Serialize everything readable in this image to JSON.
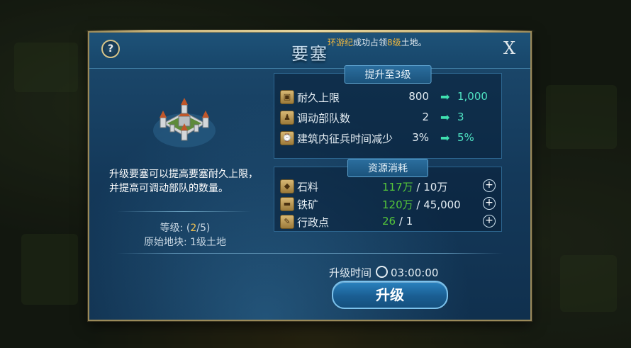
{
  "dialog": {
    "title": "要塞",
    "notice": {
      "player": "环游纪",
      "mid": "成功占领",
      "level": "8级",
      "tail": "土地。"
    },
    "help_label": "?",
    "close_label": "X"
  },
  "building": {
    "description": "升级要塞可以提高要塞耐久上限，并提高可调动部队的数量。",
    "level_label": "等级:",
    "level_open": "(",
    "level_current": "2",
    "level_rest": "/5)",
    "origin_label": "原始地块:",
    "origin_value": "1级土地"
  },
  "upgrade": {
    "header": "提升至3级",
    "rows": [
      {
        "icon": "durability-icon",
        "label": "耐久上限",
        "from": "800",
        "to": "1,000"
      },
      {
        "icon": "troop-icon",
        "label": "调动部队数",
        "from": "2",
        "to": "3"
      },
      {
        "icon": "recruit-time-icon",
        "label": "建筑内征兵时间减少",
        "from": "3%",
        "to": "5%"
      }
    ]
  },
  "resources": {
    "header": "资源消耗",
    "rows": [
      {
        "icon": "stone-icon",
        "label": "石料",
        "have": "117万",
        "need": "/ 10万"
      },
      {
        "icon": "iron-icon",
        "label": "铁矿",
        "have": "120万",
        "need": "/ 45,000"
      },
      {
        "icon": "admin-point-icon",
        "label": "行政点",
        "have": "26",
        "need": "/ 1"
      }
    ]
  },
  "footer": {
    "time_label": "升级时间",
    "time_value": "03:00:00",
    "upgrade_button": "升级"
  }
}
